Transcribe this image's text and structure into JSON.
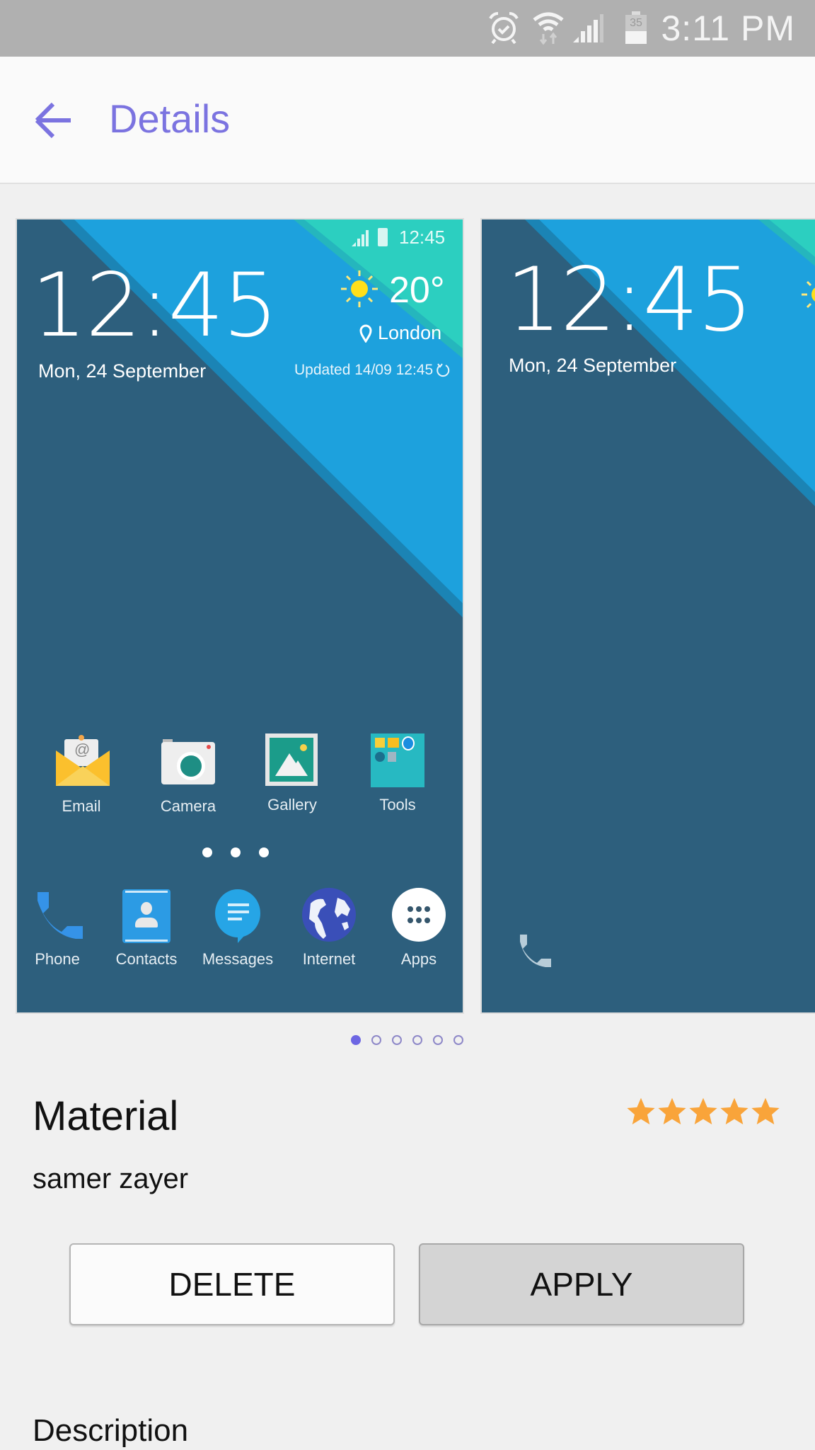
{
  "status_bar": {
    "time": "3:11 PM",
    "battery_level": "35",
    "icons": [
      "alarm-icon",
      "wifi-icon",
      "signal-icon",
      "battery-icon"
    ]
  },
  "header": {
    "back_icon": "arrow-left-icon",
    "title": "Details"
  },
  "previews": [
    {
      "name": "lock-screen-preview",
      "status_time": "12:45",
      "clock": "12:45",
      "date": "Mon, 24 September",
      "weather": {
        "icon": "sun-icon",
        "temperature": "20°",
        "location": "London",
        "updated": "Updated 14/09 12:45"
      }
    },
    {
      "name": "home-screen-preview",
      "apps": [
        {
          "label": "Email",
          "icon": "email-icon"
        },
        {
          "label": "Camera",
          "icon": "camera-icon"
        },
        {
          "label": "Gallery",
          "icon": "gallery-icon"
        },
        {
          "label": "Tools",
          "icon": "tools-folder-icon"
        }
      ],
      "dock": [
        {
          "label": "Phone",
          "icon": "phone-icon"
        },
        {
          "label": "Contacts",
          "icon": "contacts-icon"
        },
        {
          "label": "Messages",
          "icon": "messages-icon"
        },
        {
          "label": "Internet",
          "icon": "globe-icon"
        },
        {
          "label": "Apps",
          "icon": "apps-grid-icon"
        }
      ]
    },
    {
      "name": "second-lock-screen-preview",
      "clock": "12:45",
      "date": "Mon, 24 September"
    }
  ],
  "pager": {
    "count": 6,
    "active_index": 0
  },
  "theme": {
    "name": "Material",
    "author": "samer zayer",
    "rating": 5,
    "rating_max": 5
  },
  "actions": {
    "delete_label": "DELETE",
    "apply_label": "APPLY"
  },
  "description": {
    "heading": "Description"
  },
  "colors": {
    "accent": "#7b73e0",
    "star": "#f9a43a",
    "wallpaper_dark": "#2d5f7d",
    "wallpaper_blue": "#1da1dd",
    "wallpaper_teal": "#2ccfc0"
  }
}
